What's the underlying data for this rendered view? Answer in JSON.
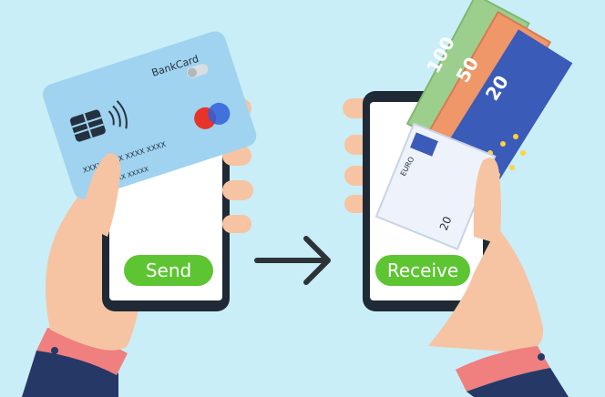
{
  "card": {
    "brand": "BankCard",
    "number": "XXXX XXXX XXXX XXXX",
    "extra_number": "XXXX XXXX XXXXX",
    "contactless_icon": "contactless-waves-icon",
    "network_logo": "two-circles-logo"
  },
  "buttons": {
    "send_label": "Send",
    "receive_label": "Receive"
  },
  "arrow_icon": "right-arrow-icon",
  "banknotes": {
    "denominations": [
      "100",
      "50",
      "20"
    ],
    "front_note_value": "20",
    "front_note_currency": "EURO"
  },
  "colors": {
    "background": "#c9eef7",
    "button_green": "#5cc531",
    "card_blue": "#9fd3ef",
    "phone_dark": "#1f2a36",
    "skin": "#f6c4a2",
    "cuff": "#f07f7f",
    "sleeve": "#263966",
    "euro_blue": "#3b5bb8",
    "note_green": "#9ccf8d",
    "note_orange": "#f0976a"
  }
}
